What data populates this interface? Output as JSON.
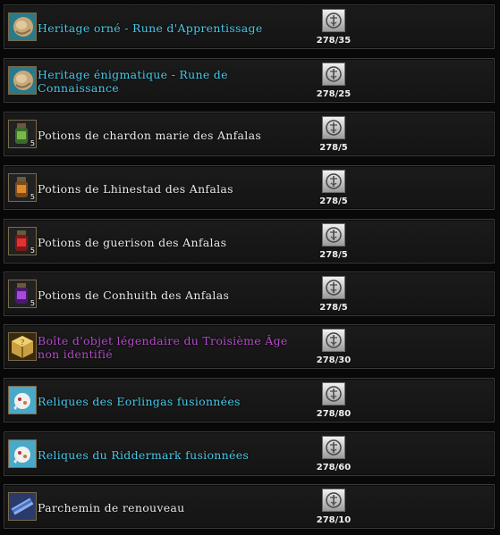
{
  "items": [
    {
      "name": "Heritage orné - Rune d'Apprentissage",
      "count": "278/35",
      "color": "cyan",
      "lines": 1,
      "icon": "rune-icon",
      "qty": ""
    },
    {
      "name": "Heritage énigmatique - Rune de Connaissance",
      "count": "278/25",
      "color": "cyan",
      "lines": 2,
      "icon": "rune-icon",
      "qty": ""
    },
    {
      "name": "Potions de chardon marie des Anfalas",
      "count": "278/5",
      "color": "white",
      "lines": 1,
      "icon": "green-potion-icon",
      "qty": "5"
    },
    {
      "name": "Potions de Lhinestad des Anfalas",
      "count": "278/5",
      "color": "white",
      "lines": 1,
      "icon": "orange-potion-icon",
      "qty": "5"
    },
    {
      "name": "Potions de guerison des Anfalas",
      "count": "278/5",
      "color": "white",
      "lines": 1,
      "icon": "red-potion-icon",
      "qty": "5"
    },
    {
      "name": "Potions de Conhuith des Anfalas",
      "count": "278/5",
      "color": "white",
      "lines": 1,
      "icon": "purple-potion-icon",
      "qty": "5"
    },
    {
      "name": "Boîte d'objet légendaire du Troisième Âge non identifié",
      "count": "278/30",
      "color": "purple",
      "lines": 2,
      "icon": "legendary-box-icon",
      "qty": ""
    },
    {
      "name": "Reliques des Eorlingas fusionnées",
      "count": "278/80",
      "color": "cyan",
      "lines": 1,
      "icon": "relic-icon",
      "qty": ""
    },
    {
      "name": "Reliques du Riddermark fusionnées",
      "count": "278/60",
      "color": "cyan",
      "lines": 1,
      "icon": "relic-icon",
      "qty": ""
    },
    {
      "name": "Parchemin de renouveau",
      "count": "278/10",
      "color": "white",
      "lines": 1,
      "icon": "scroll-icon",
      "qty": ""
    }
  ],
  "currency_icon": "token-icon",
  "colors": {
    "cyan": "#48c8e8",
    "white": "#e8e8e8",
    "purple": "#b44ac8"
  }
}
